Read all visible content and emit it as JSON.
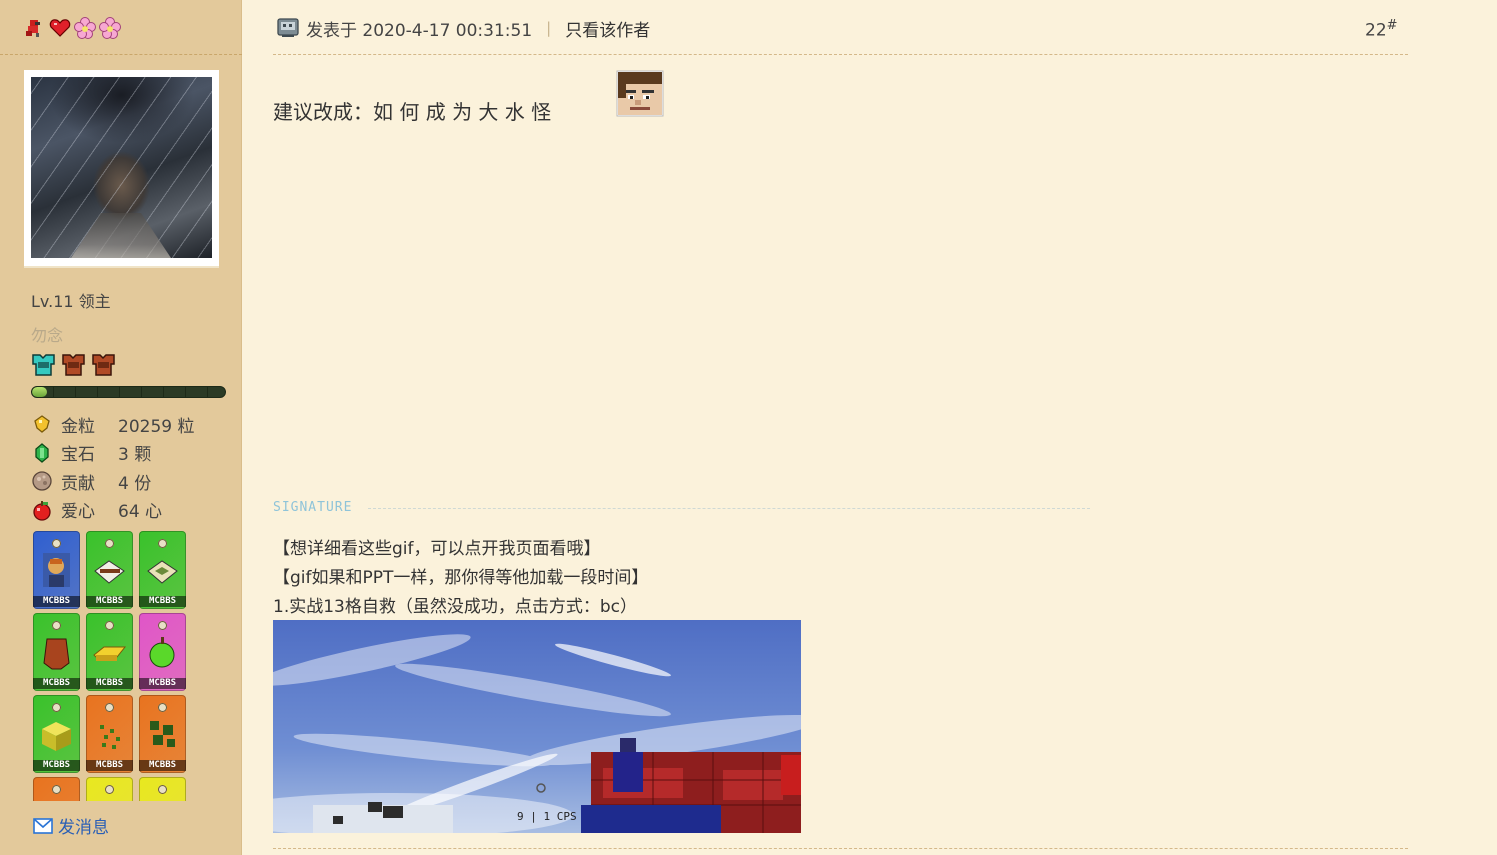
{
  "sidebar": {
    "top_icons": [
      "parrot-icon",
      "heart-icon",
      "flower-icon",
      "flower-icon"
    ],
    "level": "Lv.11 领主",
    "nickname": "勿念",
    "armor_icons": [
      "diamond-chestplate-icon",
      "leather-chestplate-icon",
      "leather-chestplate-icon"
    ],
    "xp_progress": 0.08,
    "stats": [
      {
        "icon": "gold-nugget-icon",
        "label": "金粒",
        "value": "20259 粒"
      },
      {
        "icon": "emerald-icon",
        "label": "宝石",
        "value": "3 颗"
      },
      {
        "icon": "contribution-icon",
        "label": "贡献",
        "value": "4 份"
      },
      {
        "icon": "apple-icon",
        "label": "爱心",
        "value": "64 心"
      }
    ],
    "medals": [
      {
        "icon": "portrait-medal-icon",
        "color": "#2f5fd0",
        "tag": "MCBBS"
      },
      {
        "icon": "book-medal-icon",
        "color": "#39c22b",
        "tag": "MCBBS"
      },
      {
        "icon": "map-medal-icon",
        "color": "#39c22b",
        "tag": "MCBBS"
      },
      {
        "icon": "leather-medal-icon",
        "color": "#39c22b",
        "tag": "MCBBS"
      },
      {
        "icon": "gold-ingot-medal-icon",
        "color": "#39c22b",
        "tag": "MCBBS"
      },
      {
        "icon": "green-apple-medal-icon",
        "color": "#e055c8",
        "tag": "MCBBS"
      },
      {
        "icon": "block-medal-icon",
        "color": "#39c22b",
        "tag": "MCBBS"
      },
      {
        "icon": "seeds-medal-icon",
        "color": "#e8731f",
        "tag": "MCBBS"
      },
      {
        "icon": "leaves-medal-icon",
        "color": "#e8731f",
        "tag": "MCBBS"
      },
      {
        "icon": "medal-icon",
        "color": "#e8731f",
        "tag": ""
      },
      {
        "icon": "medal-icon",
        "color": "#e8e81f",
        "tag": ""
      },
      {
        "icon": "medal-icon",
        "color": "#e8e81f",
        "tag": ""
      }
    ],
    "send_message": "发消息"
  },
  "post": {
    "posted_at": "发表于 2020-4-17 00:31:51",
    "separator": "|",
    "author_only": "只看该作者",
    "floor_number": "22",
    "floor_mark": "#",
    "content": "建议改成：如 何 成 为 大 水 怪",
    "signature_title": "SIGNATURE",
    "signature_lines": [
      "【想详细看这些gif，可以点开我页面看哦】",
      "【gif如果和PPT一样，那你得等他加载一段时间】",
      "1.实战13格自救（虽然没成功，点击方式：bc）"
    ],
    "gif_hud_text": "9 | 1 CPS"
  },
  "colors": {
    "sidebar_bg": "#e3c99b",
    "page_bg": "#fbf2db",
    "link_blue": "#2a5fb5"
  }
}
